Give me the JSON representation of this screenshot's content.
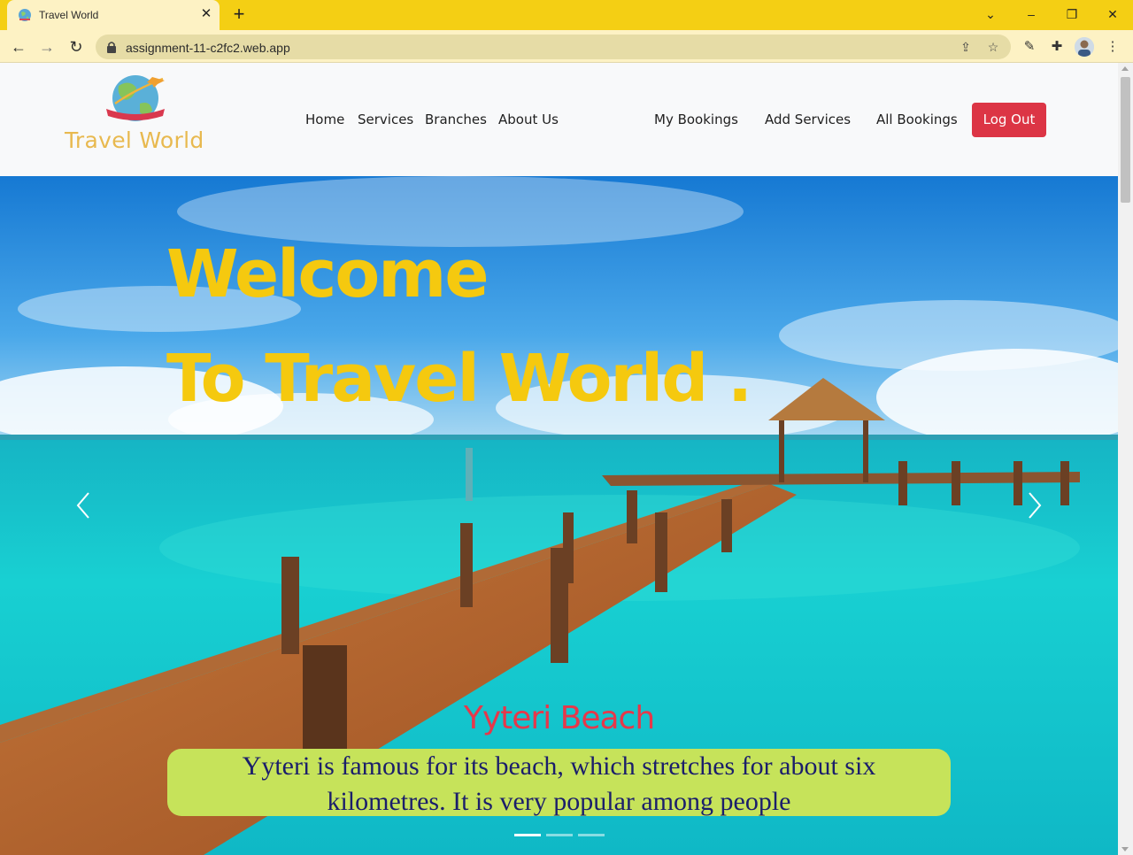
{
  "browser": {
    "tab_title": "Travel World",
    "tab_close_icon": "close-icon",
    "new_tab_icon": "plus-icon",
    "url": "assignment-11-c2fc2.web.app",
    "icons": [
      "back-icon",
      "forward-icon",
      "reload-icon",
      "lock-icon",
      "share-icon",
      "star-icon",
      "extension-icon",
      "puzzle-icon",
      "avatar",
      "menu-icon"
    ]
  },
  "site": {
    "brand": "Travel World",
    "nav_left": [
      "Home",
      "Services",
      "Branches",
      "About Us"
    ],
    "nav_right": [
      "My Bookings",
      "Add Services",
      "All Bookings"
    ],
    "logout": "Log Out"
  },
  "hero": {
    "title_line1": "Welcome",
    "title_line2": "To Travel World .",
    "slide_heading": "Yyteri Beach",
    "slide_caption_line1": "Yyteri is famous for its beach, which stretches for about six",
    "slide_caption_line2": "kilometres. It is very popular among people",
    "active_slide": 1,
    "slide_count": 3
  },
  "colors": {
    "chrome_tabstrip": "#f4cf14",
    "chrome_toolbar": "#fdf2c4",
    "brand": "#e8b94f",
    "hero_title": "#f5c90f",
    "slide_heading": "#e6384a",
    "caption_bg": "#c6e35a",
    "caption_text": "#1b1e6b",
    "logout_bg": "#dc3545"
  }
}
